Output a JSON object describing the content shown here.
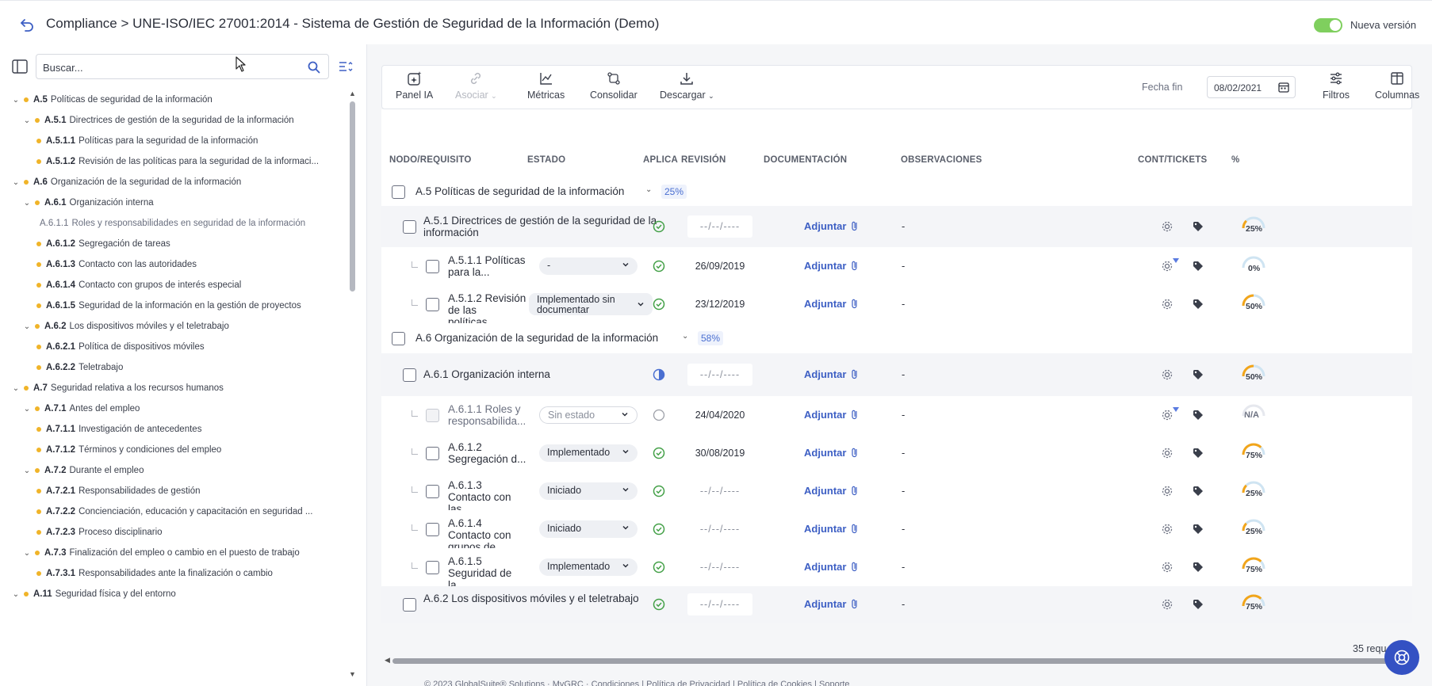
{
  "header": {
    "title": "Compliance > UNE-ISO/IEC 27001:2014 - Sistema de Gestión de Seguridad de la Información (Demo)",
    "toggle_label": "Nueva versión",
    "toggle_on": true
  },
  "sidebar": {
    "search_placeholder": "Buscar...",
    "tree": [
      {
        "level": 0,
        "expanded": true,
        "code": "A.5",
        "label": "Políticas de seguridad de la información"
      },
      {
        "level": 1,
        "expanded": true,
        "code": "A.5.1",
        "label": "Directrices de gestión de la seguridad de la información"
      },
      {
        "level": 2,
        "code": "A.5.1.1",
        "label": "Políticas para la seguridad de la información"
      },
      {
        "level": 2,
        "code": "A.5.1.2",
        "label": "Revisión de las políticas para la seguridad de la informaci..."
      },
      {
        "level": 0,
        "expanded": true,
        "code": "A.6",
        "label": "Organización de la seguridad de la información"
      },
      {
        "level": 1,
        "expanded": true,
        "code": "A.6.1",
        "label": "Organización interna"
      },
      {
        "level": 2,
        "code": "A.6.1.1",
        "label": "Roles y responsabilidades en seguridad de la información",
        "muted": true
      },
      {
        "level": 2,
        "code": "A.6.1.2",
        "label": "Segregación de tareas"
      },
      {
        "level": 2,
        "code": "A.6.1.3",
        "label": "Contacto con las autoridades"
      },
      {
        "level": 2,
        "code": "A.6.1.4",
        "label": "Contacto con grupos de interés especial"
      },
      {
        "level": 2,
        "code": "A.6.1.5",
        "label": "Seguridad de la información en la gestión de proyectos"
      },
      {
        "level": 1,
        "expanded": true,
        "code": "A.6.2",
        "label": "Los dispositivos móviles y el teletrabajo"
      },
      {
        "level": 2,
        "code": "A.6.2.1",
        "label": "Política de dispositivos móviles"
      },
      {
        "level": 2,
        "code": "A.6.2.2",
        "label": "Teletrabajo"
      },
      {
        "level": 0,
        "expanded": true,
        "code": "A.7",
        "label": "Seguridad relativa a los recursos humanos"
      },
      {
        "level": 1,
        "expanded": true,
        "code": "A.7.1",
        "label": "Antes del empleo"
      },
      {
        "level": 2,
        "code": "A.7.1.1",
        "label": "Investigación de antecedentes"
      },
      {
        "level": 2,
        "code": "A.7.1.2",
        "label": "Términos y condiciones del empleo"
      },
      {
        "level": 1,
        "expanded": true,
        "code": "A.7.2",
        "label": "Durante el empleo"
      },
      {
        "level": 2,
        "code": "A.7.2.1",
        "label": "Responsabilidades de gestión"
      },
      {
        "level": 2,
        "code": "A.7.2.2",
        "label": "Concienciación, educación y capacitación en seguridad ..."
      },
      {
        "level": 2,
        "code": "A.7.2.3",
        "label": "Proceso disciplinario"
      },
      {
        "level": 1,
        "expanded": true,
        "code": "A.7.3",
        "label": "Finalización del empleo o cambio en el puesto de trabajo"
      },
      {
        "level": 2,
        "code": "A.7.3.1",
        "label": "Responsabilidades ante la finalización o cambio"
      },
      {
        "level": 0,
        "expanded": true,
        "code": "A.11",
        "label": "Seguridad física y del entorno"
      }
    ]
  },
  "toolbar": {
    "panel_ia": "Panel IA",
    "asociar": "Asociar",
    "metricas": "Métricas",
    "consolidar": "Consolidar",
    "descargar": "Descargar",
    "fecha_fin_label": "Fecha fin",
    "fecha_fin_value": "08/02/2021",
    "filtros": "Filtros",
    "columnas": "Columnas"
  },
  "columns": {
    "nodo": "NODO/REQUISITO",
    "estado": "ESTADO",
    "aplica": "APLICA",
    "revision": "REVISIÓN",
    "documentacion": "DOCUMENTACIÓN",
    "observaciones": "OBSERVACIONES",
    "cont": "CONT/TICKETS",
    "pct": "%"
  },
  "groups": [
    {
      "title": "A.5 Políticas de seguridad de la información",
      "pct": "25%"
    },
    {
      "title": "A.6 Organización de la seguridad de la información",
      "pct": "58%"
    }
  ],
  "rows": [
    {
      "kind": "sub",
      "title": "A.5.1 Directrices de gestión de la seguridad de la información",
      "aplica": "check",
      "revision": "--/--/----",
      "doc": "Adjuntar",
      "obs": "-",
      "progress": 25,
      "pct": "25%",
      "ticket_mark": false
    },
    {
      "kind": "item",
      "title": "A.5.1.1 Políticas para la...",
      "estado": "-",
      "aplica": "check",
      "revision": "26/09/2019",
      "doc": "Adjuntar",
      "obs": "-",
      "progress": 0,
      "pct": "0%",
      "ticket_mark": true
    },
    {
      "kind": "item",
      "title": "A.5.1.2 Revisión de las políticas...",
      "estado": "Implementado sin documentar",
      "aplica": "check",
      "revision": "23/12/2019",
      "doc": "Adjuntar",
      "obs": "-",
      "progress": 50,
      "pct": "50%",
      "ticket_mark": false
    },
    {
      "kind": "sub",
      "title": "A.6.1 Organización interna",
      "aplica": "partial",
      "revision": "--/--/----",
      "doc": "Adjuntar",
      "obs": "-",
      "progress": 50,
      "pct": "50%",
      "ticket_mark": false
    },
    {
      "kind": "item",
      "title": "A.6.1.1 Roles y responsabilida...",
      "estado": "Sin estado",
      "aplica": "none",
      "revision": "24/04/2020",
      "doc": "Adjuntar",
      "obs": "-",
      "progress": null,
      "pct": "N/A",
      "ticket_mark": true,
      "disabled": true
    },
    {
      "kind": "item",
      "title": "A.6.1.2 Segregación d...",
      "estado": "Implementado",
      "aplica": "check",
      "revision": "30/08/2019",
      "doc": "Adjuntar",
      "obs": "-",
      "progress": 75,
      "pct": "75%",
      "ticket_mark": false
    },
    {
      "kind": "item",
      "title": "A.6.1.3 Contacto con las...",
      "estado": "Iniciado",
      "aplica": "check",
      "revision": "--/--/----",
      "doc": "Adjuntar",
      "obs": "-",
      "progress": 25,
      "pct": "25%",
      "ticket_mark": false
    },
    {
      "kind": "item",
      "title": "A.6.1.4 Contacto con grupos de...",
      "estado": "Iniciado",
      "aplica": "check",
      "revision": "--/--/----",
      "doc": "Adjuntar",
      "obs": "-",
      "progress": 25,
      "pct": "25%",
      "ticket_mark": false
    },
    {
      "kind": "item",
      "title": "A.6.1.5 Seguridad de la...",
      "estado": "Implementado",
      "aplica": "check",
      "revision": "--/--/----",
      "doc": "Adjuntar",
      "obs": "-",
      "progress": 75,
      "pct": "75%",
      "ticket_mark": false
    },
    {
      "kind": "sub",
      "title": "A.6.2 Los dispositivos móviles y el teletrabajo",
      "aplica": "check",
      "revision": "--/--/----",
      "doc": "Adjuntar",
      "obs": "-",
      "progress": 75,
      "pct": "75%",
      "ticket_mark": false
    }
  ],
  "footer": {
    "requirements_count": "35 requ",
    "footer_text": "© 2023 GlobalSuite® Solutions   ·   MyGRC   ·   Condiciones   |   Política de Privacidad   |   Política de Cookies   |   Soporte"
  },
  "colors": {
    "accent": "#3d5fc4",
    "check_green": "#43a047",
    "gauge_orange": "#f2a51a",
    "gauge_track": "#cfe4f2",
    "toggle_green": "#7fcf5e",
    "dot_yellow": "#f0b429"
  }
}
